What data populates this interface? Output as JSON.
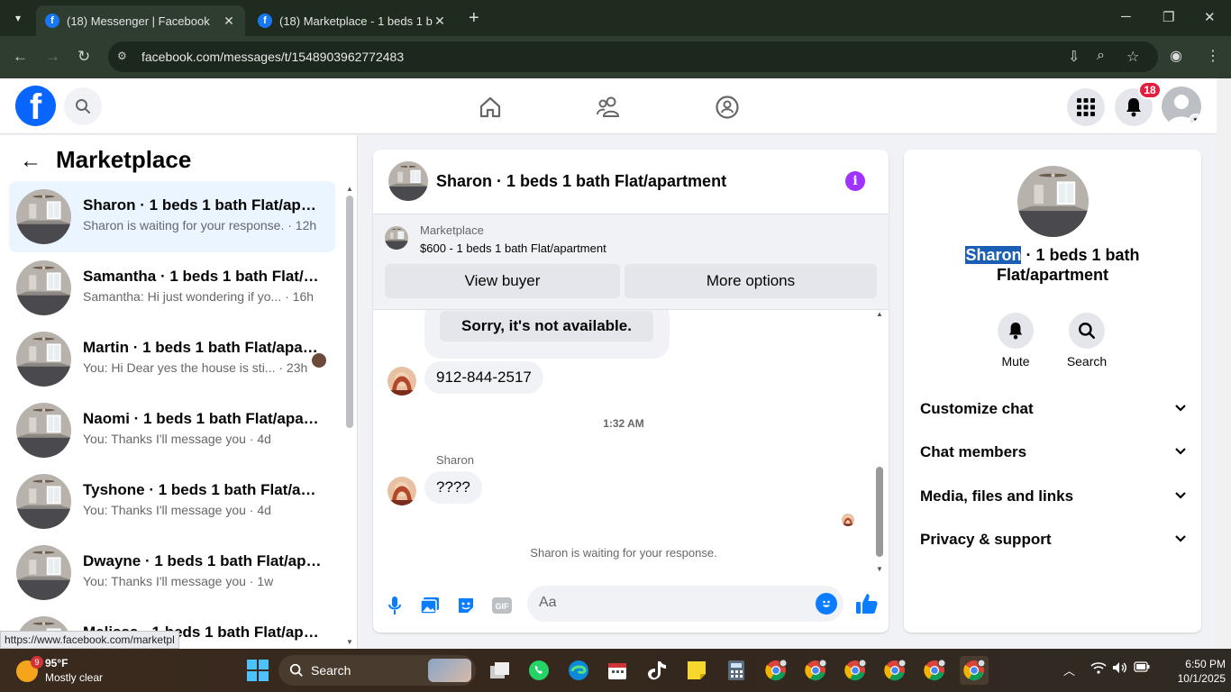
{
  "browser": {
    "tabs": [
      {
        "title": "(18) Messenger | Facebook",
        "favicon": "f"
      },
      {
        "title": "(18) Marketplace - 1 beds 1 bath",
        "favicon": "f"
      }
    ],
    "url": "facebook.com/messages/t/1548903962772483",
    "status_url": "https://www.facebook.com/marketpl"
  },
  "header": {
    "notif_count": "18"
  },
  "left": {
    "title": "Marketplace",
    "conversations": [
      {
        "name": "Sharon · 1 beds 1 bath Flat/apartment",
        "preview": "Sharon is waiting for your response. · 12h",
        "selected": true
      },
      {
        "name": "Samantha · 1 beds 1 bath Flat/apartment",
        "preview": "Samantha: Hi just wondering if yo... · 16h"
      },
      {
        "name": "Martin · 1 beds 1 bath Flat/apartment",
        "preview": "You: Hi Dear yes the house is sti... · 23h"
      },
      {
        "name": "Naomi · 1 beds 1 bath Flat/apartment",
        "preview": "You: Thanks I'll message you · 4d"
      },
      {
        "name": "Tyshone · 1 beds 1 bath Flat/apartment",
        "preview": "You: Thanks I'll message you · 4d"
      },
      {
        "name": "Dwayne · 1 beds 1 bath Flat/apartment",
        "preview": "You: Thanks I'll message you · 1w"
      },
      {
        "name": "Melissa · 1 beds 1 bath Flat/apartment",
        "preview": ""
      }
    ]
  },
  "chat": {
    "title": "Sharon · 1 beds 1 bath Flat/apartment",
    "marketplace_label": "Marketplace",
    "listing": "$600 - 1 beds 1 bath Flat/apartment",
    "view_buyer": "View buyer",
    "more_options": "More options",
    "sorry_button": "Sorry, it's not available.",
    "msg_phone": "912-844-2517",
    "timestamp": "1:32 AM",
    "sender": "Sharon",
    "msg_q": "????",
    "waiting": "Sharon is waiting for your response.",
    "input_placeholder": "Aa"
  },
  "info": {
    "name_highlight": "Sharon",
    "name_rest": " · 1 beds 1 bath Flat/apartment",
    "mute": "Mute",
    "search": "Search",
    "rows": [
      "Customize chat",
      "Chat members",
      "Media, files and links",
      "Privacy & support"
    ]
  },
  "taskbar": {
    "weather_badge": "9",
    "temp": "95°F",
    "condition": "Mostly clear",
    "search": "Search",
    "time": "6:50 PM",
    "date": "10/1/2025"
  },
  "colors": {
    "fb_blue": "#0866ff",
    "messenger_accent": "#a033ff",
    "selected_row": "#ebf5ff",
    "badge_red": "#e41e3f"
  }
}
